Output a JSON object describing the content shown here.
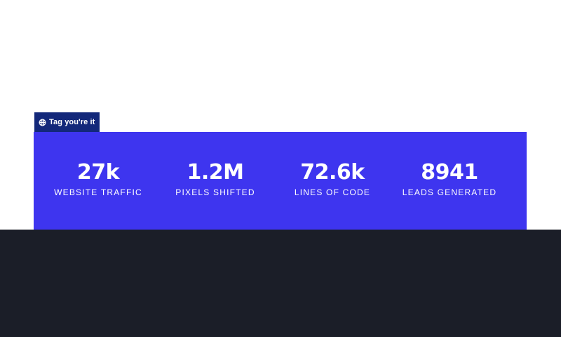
{
  "badge": {
    "icon": "globe-icon",
    "label": "Tag you're it"
  },
  "colors": {
    "panel": "#3e35ef",
    "badge": "#13287a",
    "footer": "#1b1e28",
    "text": "#ffffff"
  },
  "stats": [
    {
      "value": "27k",
      "label": "WEBSITE TRAFFIC"
    },
    {
      "value": "1.2M",
      "label": "PIXELS SHIFTED"
    },
    {
      "value": "72.6k",
      "label": "LINES OF CODE"
    },
    {
      "value": "8941",
      "label": "LEADS GENERATED"
    }
  ]
}
